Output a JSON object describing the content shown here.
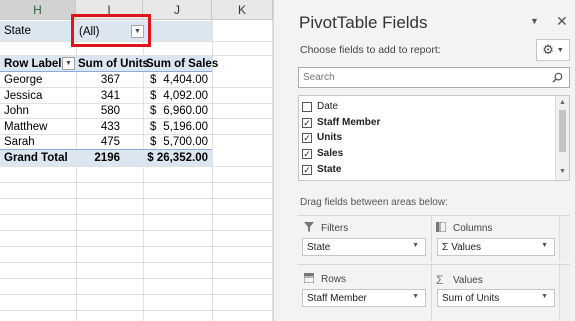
{
  "sheet": {
    "columns": [
      {
        "label": "H",
        "selected": true
      },
      {
        "label": "I",
        "selected": false
      },
      {
        "label": "J",
        "selected": false
      },
      {
        "label": "K",
        "selected": false
      }
    ],
    "filter": {
      "field": "State",
      "value": "(All)"
    },
    "headers": {
      "row_labels": "Row Labels",
      "units": "Sum of Units",
      "sales": "Sum of Sales"
    },
    "rows": [
      {
        "name": "George",
        "units": "367",
        "currency": "$",
        "sales": "4,404.00"
      },
      {
        "name": "Jessica",
        "units": "341",
        "currency": "$",
        "sales": "4,092.00"
      },
      {
        "name": "John",
        "units": "580",
        "currency": "$",
        "sales": "6,960.00"
      },
      {
        "name": "Matthew",
        "units": "433",
        "currency": "$",
        "sales": "5,196.00"
      },
      {
        "name": "Sarah",
        "units": "475",
        "currency": "$",
        "sales": "5,700.00"
      }
    ],
    "total": {
      "name": "Grand Total",
      "units": "2196",
      "sales": "$ 26,352.00"
    },
    "highlight_color": "#e0141b",
    "header_fill": "#dce6f1"
  },
  "pane": {
    "title": "PivotTable Fields",
    "choose_label": "Choose fields to add to report:",
    "search_placeholder": "Search",
    "fields": [
      {
        "label": "Date",
        "checked": false
      },
      {
        "label": "Staff Member",
        "checked": true
      },
      {
        "label": "Units",
        "checked": true
      },
      {
        "label": "Sales",
        "checked": true
      },
      {
        "label": "State",
        "checked": true
      }
    ],
    "drag_label": "Drag fields between areas below:",
    "areas": {
      "filters": {
        "label": "Filters",
        "item": "State"
      },
      "columns": {
        "label": "Columns",
        "item": "Values"
      },
      "rows": {
        "label": "Rows",
        "item": "Staff Member"
      },
      "values": {
        "label": "Values",
        "item": "Sum of Units"
      }
    },
    "icons": [
      "chevron-down-icon",
      "close-icon",
      "gear-icon",
      "search-icon",
      "filter-icon",
      "columns-icon",
      "rows-icon",
      "sigma-icon"
    ]
  }
}
